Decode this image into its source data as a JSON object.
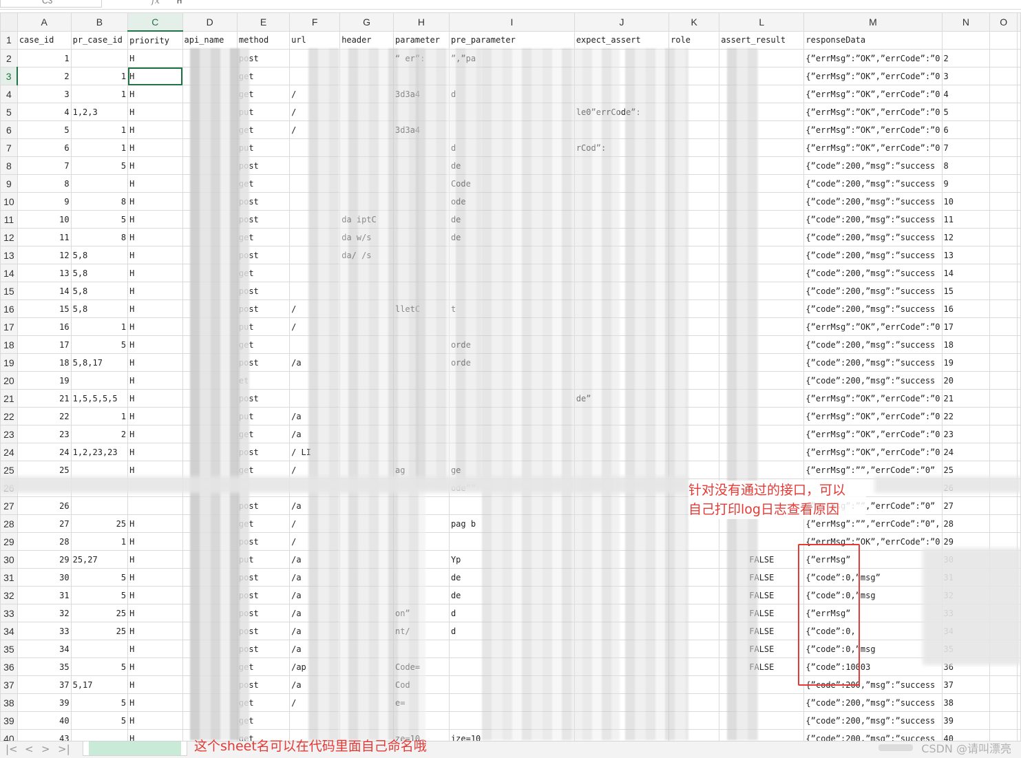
{
  "formula_bar": {
    "name_box": "C3",
    "fx": "fx",
    "value": "H"
  },
  "columns": [
    "A",
    "B",
    "C",
    "D",
    "E",
    "F",
    "G",
    "H",
    "I",
    "J",
    "K",
    "L",
    "M",
    "N",
    "O"
  ],
  "header_row": [
    "case_id",
    "pr_case_id",
    "priority",
    "api_name",
    "method",
    "url",
    "header",
    "parameter",
    "pre_parameter",
    "expect_assert",
    "role",
    "assert_result",
    "responseData",
    "",
    ""
  ],
  "rows": [
    {
      "n": "2",
      "a": "1",
      "b": "",
      "c": "H",
      "e": "post",
      "h": "“   er”:",
      "i": "   ”,”pa",
      "l": "",
      "m": "{”errMsg”:”OK”,”errCode”:”0"
    },
    {
      "n": "3",
      "a": "2",
      "b": "1",
      "c": "H",
      "e": "get",
      "h": "",
      "i": "",
      "l": "",
      "m": "{”errMsg”:”OK”,”errCode”:”0"
    },
    {
      "n": "4",
      "a": "3",
      "b": "1",
      "c": "H",
      "e": "get",
      "f": "/",
      "h": "3d3a4",
      "i": "d",
      "l": "",
      "m": "{”errMsg”:”OK”,”errCode”:”0"
    },
    {
      "n": "5",
      "a": "4",
      "b": "1,2,3",
      "c": "H",
      "e": "put",
      "f": "/",
      "j": "le0”errCode”:",
      "l": "",
      "m": "{”errMsg”:”OK”,”errCode”:”0"
    },
    {
      "n": "6",
      "a": "5",
      "b": "1",
      "c": "H",
      "e": "get",
      "f": "/",
      "h": "3d3a4",
      "l": "",
      "m": "{”errMsg”:”OK”,”errCode”:”0"
    },
    {
      "n": "7",
      "a": "6",
      "b": "1",
      "c": "H",
      "e": "put",
      "i": "d",
      "j": "rCod”:",
      "l": "",
      "m": "{”errMsg”:”OK”,”errCode”:”0"
    },
    {
      "n": "8",
      "a": "7",
      "b": "5",
      "c": "H",
      "e": "post",
      "i": "de",
      "l": "",
      "m": "{”code”:200,”msg”:”success"
    },
    {
      "n": "9",
      "a": "8",
      "b": "",
      "c": "H",
      "e": "get",
      "i": "Code",
      "l": "",
      "m": "{”code”:200,”msg”:”success"
    },
    {
      "n": "10",
      "a": "9",
      "b": "8",
      "c": "H",
      "e": "post",
      "i": "ode",
      "l": "",
      "m": "{”code”:200,”msg”:”success"
    },
    {
      "n": "11",
      "a": "10",
      "b": "5",
      "c": "H",
      "e": "post",
      "g": "da   iptC",
      "i": "de",
      "l": "",
      "m": "{”code”:200,”msg”:”success"
    },
    {
      "n": "12",
      "a": "11",
      "b": "8",
      "c": "H",
      "e": "get",
      "g": "da   w/s",
      "i": "de",
      "l": "",
      "m": "{”code”:200,”msg”:”success"
    },
    {
      "n": "13",
      "a": "12",
      "b": "5,8",
      "c": "H",
      "e": "post",
      "g": "da/  /s",
      "l": "",
      "m": "{”code”:200,”msg”:”success"
    },
    {
      "n": "14",
      "a": "13",
      "b": "5,8",
      "c": "H",
      "e": "get",
      "l": "",
      "m": "{”code”:200,”msg”:”success"
    },
    {
      "n": "15",
      "a": "14",
      "b": "5,8",
      "c": "H",
      "e": "post",
      "l": "",
      "m": "{”code”:200,”msg”:”success"
    },
    {
      "n": "16",
      "a": "15",
      "b": "5,8",
      "c": "H",
      "e": "post",
      "f": "/",
      "h": "lletC",
      "i": "t",
      "l": "",
      "m": "{”code”:200,”msg”:”success"
    },
    {
      "n": "17",
      "a": "16",
      "b": "1",
      "c": "H",
      "e": "put",
      "f": "/",
      "l": "",
      "m": "{”errMsg”:”OK”,”errCode”:”0"
    },
    {
      "n": "18",
      "a": "17",
      "b": "5",
      "c": "H",
      "e": "get",
      "i": "orde",
      "l": "",
      "m": "{”code”:200,”msg”:”success"
    },
    {
      "n": "19",
      "a": "18",
      "b": "5,8,17",
      "c": "H",
      "e": "post",
      "f": "/a",
      "i": "orde",
      "l": "",
      "m": "{”code”:200,”msg”:”success"
    },
    {
      "n": "20",
      "a": "19",
      "b": "",
      "c": "H",
      "e": "et",
      "l": "",
      "m": "{”code”:200,”msg”:”success"
    },
    {
      "n": "21",
      "a": "21",
      "b": "1,5,5,5,5",
      "c": "H",
      "e": "post",
      "j": "de”",
      "l": "",
      "m": "{”errMsg”:”OK”,”errCode”:”0"
    },
    {
      "n": "22",
      "a": "22",
      "b": "1",
      "c": "H",
      "e": "put",
      "f": "/a",
      "l": "",
      "m": "{”errMsg”:”OK”,”errCode”:”0"
    },
    {
      "n": "23",
      "a": "23",
      "b": "2",
      "c": "H",
      "e": "get",
      "f": "/a",
      "l": "",
      "m": "{”errMsg”:”OK”,”errCode”:”0"
    },
    {
      "n": "24",
      "a": "24",
      "b": "1,2,23,23",
      "c": "H",
      "e": "post",
      "f": "/   LI",
      "l": "",
      "m": "{”errMsg”:”OK”,”errCode”:”0"
    },
    {
      "n": "25",
      "a": "25",
      "b": "",
      "c": "H",
      "e": "get",
      "f": "/",
      "h": "ag",
      "i": "ge",
      "l": "",
      "m": "{”errMsg”:””,”errCode”:”0”"
    },
    {
      "n": "26",
      "a": "",
      "b": "",
      "c": "",
      "e": "",
      "i": "ode””",
      "l": "",
      "m": ""
    },
    {
      "n": "27",
      "a": "26",
      "b": "",
      "c": "",
      "e": "post",
      "f": "/a",
      "l": "",
      "m": "{”errMsg”:””,”errCode”:”0”"
    },
    {
      "n": "28",
      "a": "27",
      "b": "25",
      "c": "H",
      "e": "get",
      "f": "/",
      "i": "pag b",
      "l": "",
      "m": "{”errMsg”:””,”errCode”:”0”,"
    },
    {
      "n": "29",
      "a": "28",
      "b": "1",
      "c": "H",
      "e": "post",
      "f": "/",
      "l": "",
      "m": "{”errMsg”:”OK”,”errCode”:”0"
    },
    {
      "n": "30",
      "a": "29",
      "b": "25,27",
      "c": "H",
      "e": "put",
      "f": "/a",
      "i": "Yp",
      "l": "FALSE",
      "m": "{”errMsg”"
    },
    {
      "n": "31",
      "a": "30",
      "b": "5",
      "c": "H",
      "e": "post",
      "f": "/a",
      "i": "de",
      "l": "FALSE",
      "m": "{”code”:0,”msg”"
    },
    {
      "n": "32",
      "a": "31",
      "b": "5",
      "c": "H",
      "e": "post",
      "f": "/a",
      "i": "de",
      "l": "FALSE",
      "m": "{”code”:0,”msg"
    },
    {
      "n": "33",
      "a": "32",
      "b": "25",
      "c": "H",
      "e": "post",
      "f": "/a",
      "h": "on”",
      "i": "d",
      "l": "FALSE",
      "m": "{”errMsg”"
    },
    {
      "n": "34",
      "a": "33",
      "b": "25",
      "c": "H",
      "e": "post",
      "f": "/a",
      "h": "nt/",
      "i": "d",
      "l": "FALSE",
      "m": "{”code”:0,"
    },
    {
      "n": "35",
      "a": "34",
      "b": "",
      "c": "H",
      "e": "post",
      "f": "/a",
      "l": "FALSE",
      "m": "{”code”:0,”msg"
    },
    {
      "n": "36",
      "a": "35",
      "b": "5",
      "c": "H",
      "e": "get",
      "f": "/ap",
      "h": "Code=",
      "l": "FALSE",
      "m": "{”code”:10003"
    },
    {
      "n": "37",
      "a": "37",
      "b": "5,17",
      "c": "H",
      "e": "post",
      "f": "/a",
      "h": "Cod",
      "l": "",
      "m": "{”code”:200,”msg”:”success"
    },
    {
      "n": "38",
      "a": "39",
      "b": "5",
      "c": "H",
      "e": "get",
      "f": "/",
      "h": "e=",
      "l": "",
      "m": "{”code”:200,”msg”:”success"
    },
    {
      "n": "39",
      "a": "40",
      "b": "5",
      "c": "H",
      "e": "get",
      "l": "",
      "m": "{”code”:200,”msg”:”success"
    },
    {
      "n": "40",
      "a": "43",
      "b": "",
      "c": "H",
      "e": "get",
      "h": "ze=10",
      "i": "ize=10",
      "l": "",
      "m": "{”code”:200,”msg”:”success"
    }
  ],
  "annotations": {
    "note_line1": "针对没有通过的接口，可以",
    "note_line2": "自己打印log日志查看原因",
    "sheet_note": "这个sheet名可以在代码里面自己命名哦"
  },
  "footer": {
    "nav_first": "|<",
    "nav_prev": "<",
    "nav_next": ">",
    "nav_last": ">|",
    "watermark": "CSDN @请叫漂亮"
  },
  "colors": {
    "accent": "#217346",
    "annotation_red": "#e53935"
  }
}
